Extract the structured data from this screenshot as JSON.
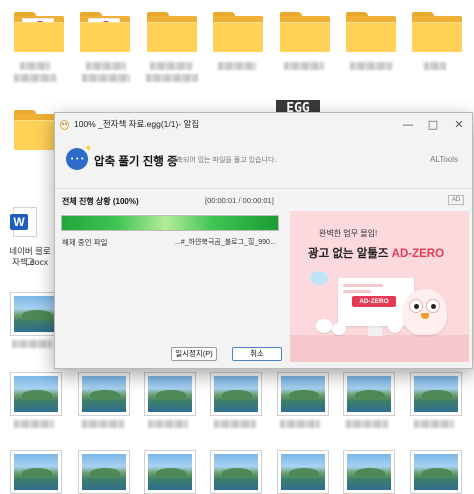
{
  "dialog": {
    "title": "100% _전자책 자료.egg(1/1)- 알집",
    "header_title": "압축 풀기 진행 중",
    "header_subtitle": "압축되어 있는 파일을 풀고 있습니다.",
    "brand": "ALTools",
    "progress_label": "전체 진행 상황 (100%)",
    "progress_time": "[00:00:01 / 00:00:01]",
    "progress_fraction": 1.0,
    "file_label": "해제 중인 파일",
    "file_name": "...#_하얀북극곰_블로그_힐_990...",
    "ad_tag": "AD",
    "pause_button": "일시정지(P)",
    "cancel_button": "취소",
    "icons": {
      "app": "alzip-egg-icon",
      "header": "extract-progress-icon",
      "minimize": "minimize-icon",
      "maximize": "maximize-icon",
      "close": "close-icon"
    }
  },
  "ad": {
    "line1": "완벽한 업무 몰입!",
    "line2_prefix": "광고 없는 알툴즈 ",
    "line2_highlight": "AD-ZERO",
    "monitor_badge": "AD-ZERO",
    "colors": {
      "background": "#fbd9dc",
      "accent": "#e53a55"
    }
  },
  "desktop": {
    "egg_badge": "EGG",
    "word_file_label_line1": "네이버 블로그",
    "word_file_label_line2": "자책.docx"
  },
  "colors": {
    "progress_fill": "#3dc452",
    "folder": "#ffd257"
  }
}
